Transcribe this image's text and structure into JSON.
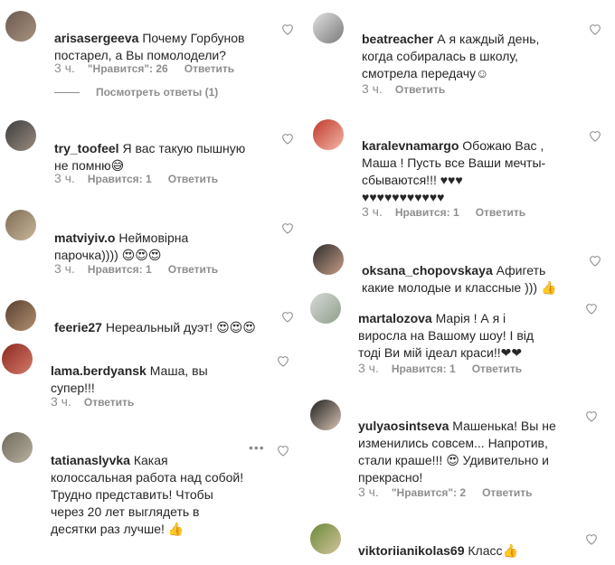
{
  "left": [
    {
      "user": "arisasergeeva",
      "text": "Почему Горбунов\nпостарел, а Вы помолодели?",
      "time": "3 ч.",
      "likes": "\"Нравится\": 26",
      "reply": "Ответить",
      "view_replies": "Посмотреть ответы (1)"
    },
    {
      "user": "try_toofeel",
      "text": "Я вас такую пышную\nне помню😅",
      "time": "3 ч.",
      "likes": "Нравится: 1",
      "reply": "Ответить"
    },
    {
      "user": "matviyiv.o",
      "text": "Неймовірна\nпарочка)))) 😍😍😍",
      "time": "3 ч.",
      "likes": "Нравится: 1",
      "reply": "Ответить"
    },
    {
      "user": "feerie27",
      "text": "Нереальный дуэт! 😍😍😍"
    },
    {
      "user": "lama.berdyansk",
      "text": "Маша, вы\nсупер!!!",
      "time": "3 ч.",
      "reply": "Ответить"
    },
    {
      "user": "tatianaslyvka",
      "text": "Какая\nколоссальная работа над собой!\nТрудно представить! Чтобы\nчерез 20 лет выглядеть в\nдесятки раз лучше! 👍"
    }
  ],
  "right": [
    {
      "user": "beatreacher",
      "text": "А я каждый день,\nкогда собиралась в школу,\nсмотрела передачу☺",
      "time": "3 ч.",
      "reply": "Ответить"
    },
    {
      "user": "karalevnamargo",
      "text": "Обожаю Вас ,\nМаша ! Пусть все Ваши мечты-\nсбываются!!! ♥♥♥\n♥♥♥♥♥♥♥♥♥♥♥",
      "time": "3 ч.",
      "likes": "Нравится: 1",
      "reply": "Ответить"
    },
    {
      "user": "oksana_chopovskaya",
      "text": "Афигеть\nкакие молодые и классные ))) 👍"
    },
    {
      "user": "martalozova",
      "text": "Марія ! А я і\nвиросла на Вашому шоу! І від\nтоді Ви мій ідеал краси!!❤❤",
      "time": "3 ч.",
      "likes": "Нравится: 1",
      "reply": "Ответить"
    },
    {
      "user": "yulyaosintseva",
      "text": "Машенька! Вы не\nизменились совсем... Напротив,\nстали краше!!! 😍 Удивительно и\nпрекрасно!",
      "time": "3 ч.",
      "likes": "\"Нравится\": 2",
      "reply": "Ответить"
    },
    {
      "user": "viktoriianikolas69",
      "text": "Класс👍"
    }
  ],
  "colors": {
    "text": "#262626",
    "meta": "#8e8e8e",
    "bg": "#ffffff"
  },
  "icons": {
    "like": "heart-outline-icon",
    "more": "more-options-icon"
  }
}
